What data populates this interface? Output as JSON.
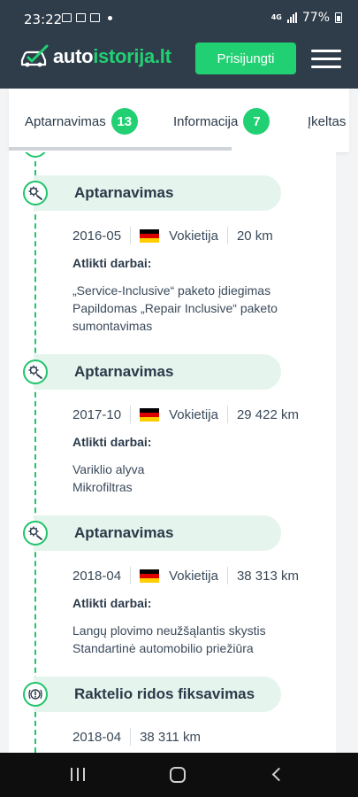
{
  "status_bar": {
    "time": "23:22",
    "network": "4G",
    "battery": "77%"
  },
  "header": {
    "logo_part1": "auto",
    "logo_part2": "istorija.lt",
    "login_label": "Prisijungti"
  },
  "tabs": [
    {
      "label": "Aptarnavimas",
      "count": "13"
    },
    {
      "label": "Informacija",
      "count": "7"
    },
    {
      "label": "Įkeltas"
    }
  ],
  "entries": [
    {
      "title": "Aptarnavimas",
      "icon": "service-gears-icon",
      "date": "2016-05",
      "country": "Vokietija",
      "mileage": "20 km",
      "works_label": "Atlikti darbai:",
      "works": [
        "„Service-Inclusive“ paketo įdiegimas",
        "Papildomas „Repair Inclusive“ paketo sumontavimas"
      ]
    },
    {
      "title": "Aptarnavimas",
      "icon": "service-gears-icon",
      "date": "2017-10",
      "country": "Vokietija",
      "mileage": "29 422 km",
      "works_label": "Atlikti darbai:",
      "works": [
        "Variklio alyva",
        "Mikrofiltras"
      ]
    },
    {
      "title": "Aptarnavimas",
      "icon": "service-gears-icon",
      "date": "2018-04",
      "country": "Vokietija",
      "mileage": "38 313 km",
      "works_label": "Atlikti darbai:",
      "works": [
        "Langų plovimo neužšąlantis skystis",
        "Standartinė automobilio priežiūra"
      ]
    },
    {
      "title": "Raktelio ridos fiksavimas",
      "icon": "key-warning-icon",
      "date": "2018-04",
      "mileage": "38 311 km"
    }
  ],
  "colors": {
    "header_bg": "#2f3d4b",
    "accent_green": "#21d072",
    "pill_bg": "#e5f4ec"
  }
}
